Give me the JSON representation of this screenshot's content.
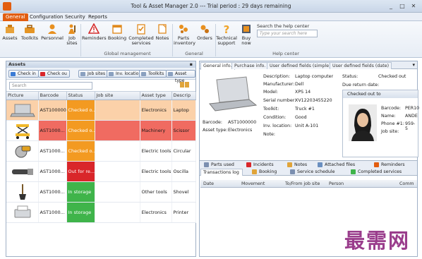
{
  "window": {
    "title": "Tool & Asset Manager 2.0 --- Trial period : 29 days remaining",
    "controls": [
      "_",
      "□",
      "✕"
    ]
  },
  "menu": [
    "General",
    "Configuration",
    "Security",
    "Reports"
  ],
  "ribbon": {
    "buttons": [
      {
        "label": "Assets",
        "icon": "assets-icon"
      },
      {
        "label": "Toolkits",
        "icon": "toolkits-icon"
      },
      {
        "label": "Personnel",
        "icon": "personnel-icon"
      },
      {
        "label": "Job sites",
        "icon": "job-sites-icon"
      },
      {
        "label": "Reminders",
        "icon": "reminders-icon"
      },
      {
        "label": "Booking",
        "icon": "booking-icon"
      },
      {
        "label": "Completed services",
        "icon": "completed-services-icon"
      },
      {
        "label": "Notes",
        "icon": "notes-icon"
      },
      {
        "label": "Parts inventory",
        "icon": "parts-inventory-icon"
      },
      {
        "label": "Orders",
        "icon": "orders-icon"
      },
      {
        "label": "Technical support",
        "icon": "technical-support-icon"
      },
      {
        "label": "Buy now",
        "icon": "buy-now-icon"
      }
    ],
    "groups": [
      "Global management",
      "General",
      "Help center"
    ],
    "search": {
      "title": "Search the help center",
      "placeholder": "Type your search here"
    }
  },
  "assets_panel": {
    "title": "Assets",
    "toolbar": [
      "Check in",
      "Check ou",
      "Job sites",
      "Inv. locations",
      "Toolkits",
      "Asset type"
    ],
    "filter_placeholder": "Search",
    "columns": [
      "Picture",
      "Barcode",
      "Status",
      "Job site",
      "Asset type",
      "Descrip"
    ],
    "rows": [
      {
        "picture": "laptop-icon",
        "barcode": "AST100000...",
        "status": "Checked o...",
        "job_site": "",
        "asset_type": "Electronics",
        "description": "Laptop"
      },
      {
        "picture": "scissor-lift-icon",
        "barcode": "AST1000...",
        "status": "Checked o...",
        "job_site": "",
        "asset_type": "Machinery",
        "description": "Scissor"
      },
      {
        "picture": "circular-saw-icon",
        "barcode": "AST1000...",
        "status": "Checked o...",
        "job_site": "",
        "asset_type": "Electric tools",
        "description": "Circular"
      },
      {
        "picture": "oscillating-tool-icon",
        "barcode": "AST1000...",
        "status": "Out for re...",
        "job_site": "",
        "asset_type": "Electric tools",
        "description": "Oscilla"
      },
      {
        "picture": "shovel-icon",
        "barcode": "AST1000...",
        "status": "In storage",
        "job_site": "",
        "asset_type": "Other tools",
        "description": "Shovel"
      },
      {
        "picture": "printer-icon",
        "barcode": "AST1000...",
        "status": "In storage",
        "job_site": "",
        "asset_type": "Electronics",
        "description": "Printer"
      }
    ]
  },
  "detail_panel": {
    "tabs": [
      "General info.",
      "Purchase info.",
      "User defined fields (simple)",
      "User defined fields (date)"
    ],
    "barcode_label": "Barcode:",
    "barcode_value": "AST1000000",
    "asset_type_label": "Asset type:",
    "asset_type_value": "Electronics",
    "fields": [
      {
        "label": "Description:",
        "value": "Laptop computer"
      },
      {
        "label": "Manufacturer:",
        "value": "Dell"
      },
      {
        "label": "Model:",
        "value": "XPS 14"
      },
      {
        "label": "Serial number:",
        "value": "XV12203455220"
      },
      {
        "label": "Toolkit:",
        "value": "Truck #1"
      },
      {
        "label": "Condition:",
        "value": "Good"
      },
      {
        "label": "Inv. location:",
        "value": "Unit A-101"
      },
      {
        "label": "Note:",
        "value": ""
      }
    ],
    "status_label": "Status:",
    "status_value": "Checked out",
    "due_label": "Due return date:",
    "checked_out_to": {
      "title": "Checked out to",
      "barcode_label": "Barcode:",
      "barcode_value": "PER10",
      "name_label": "Name:",
      "name_value": "ANDE",
      "phone_label": "Phone #1:",
      "phone_value": "959-5",
      "job_site_label": "Job site:"
    },
    "bottom_tabs_row1": [
      "Parts used",
      "Incidents",
      "Notes",
      "Attached files",
      "Reminders"
    ],
    "bottom_tabs_row2": [
      "Transactions log",
      "Booking",
      "Service schedule",
      "Completed services"
    ],
    "log_columns": [
      "Date",
      "Movement",
      "To/From job site",
      "Person",
      "Comm"
    ]
  },
  "watermark": "最需网",
  "colors": {
    "accent": "#e25d10",
    "checked_out": "#f39a21",
    "overdue": "#d9262a",
    "in_storage": "#3fb44a"
  }
}
